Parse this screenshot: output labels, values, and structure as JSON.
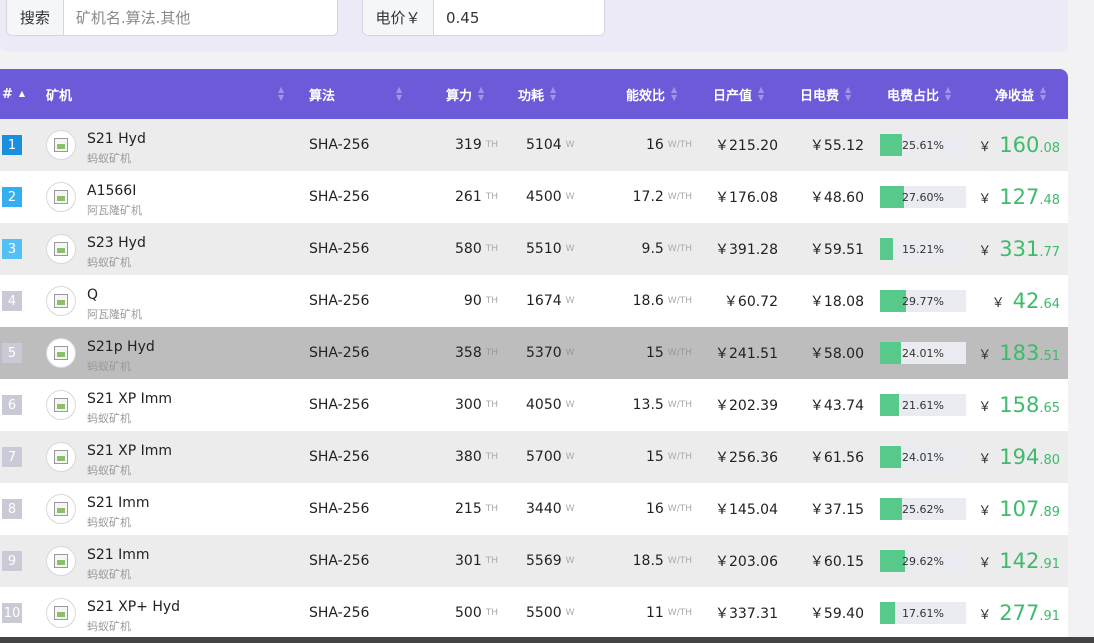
{
  "search": {
    "label": "搜索",
    "placeholder": "矿机名.算法.其他",
    "value": ""
  },
  "price": {
    "label": "电价￥",
    "value": "0.45"
  },
  "headers": {
    "rank": "#",
    "miner": "矿机",
    "algo": "算法",
    "hashrate": "算力",
    "power": "功耗",
    "efficiency": "能效比",
    "daily_output": "日产值",
    "daily_cost": "日电费",
    "cost_ratio": "电费占比",
    "net": "净收益"
  },
  "units": {
    "hash": "TH",
    "power": "W",
    "eff": "W/TH",
    "currency": "￥"
  },
  "rows": [
    {
      "rank": "1",
      "name": "S21 Hyd",
      "brand": "蚂蚁矿机",
      "algo": "SHA-256",
      "hash": "319",
      "power": "5104",
      "eff": "16",
      "output": "￥215.20",
      "cost": "￥55.12",
      "ratio": "25.61%",
      "ratio_value": 25.61,
      "net_int": "160",
      "net_dec": ".08"
    },
    {
      "rank": "2",
      "name": "A1566I",
      "brand": "阿瓦隆矿机",
      "algo": "SHA-256",
      "hash": "261",
      "power": "4500",
      "eff": "17.2",
      "output": "￥176.08",
      "cost": "￥48.60",
      "ratio": "27.60%",
      "ratio_value": 27.6,
      "net_int": "127",
      "net_dec": ".48"
    },
    {
      "rank": "3",
      "name": "S23 Hyd",
      "brand": "蚂蚁矿机",
      "algo": "SHA-256",
      "hash": "580",
      "power": "5510",
      "eff": "9.5",
      "output": "￥391.28",
      "cost": "￥59.51",
      "ratio": "15.21%",
      "ratio_value": 15.21,
      "net_int": "331",
      "net_dec": ".77"
    },
    {
      "rank": "4",
      "name": "Q",
      "brand": "阿瓦隆矿机",
      "algo": "SHA-256",
      "hash": "90",
      "power": "1674",
      "eff": "18.6",
      "output": "￥60.72",
      "cost": "￥18.08",
      "ratio": "29.77%",
      "ratio_value": 29.77,
      "net_int": "42",
      "net_dec": ".64"
    },
    {
      "rank": "5",
      "name": "S21p Hyd",
      "brand": "蚂蚁矿机",
      "algo": "SHA-256",
      "hash": "358",
      "power": "5370",
      "eff": "15",
      "output": "￥241.51",
      "cost": "￥58.00",
      "ratio": "24.01%",
      "ratio_value": 24.01,
      "net_int": "183",
      "net_dec": ".51"
    },
    {
      "rank": "6",
      "name": "S21 XP Imm",
      "brand": "蚂蚁矿机",
      "algo": "SHA-256",
      "hash": "300",
      "power": "4050",
      "eff": "13.5",
      "output": "￥202.39",
      "cost": "￥43.74",
      "ratio": "21.61%",
      "ratio_value": 21.61,
      "net_int": "158",
      "net_dec": ".65"
    },
    {
      "rank": "7",
      "name": "S21 XP Imm",
      "brand": "蚂蚁矿机",
      "algo": "SHA-256",
      "hash": "380",
      "power": "5700",
      "eff": "15",
      "output": "￥256.36",
      "cost": "￥61.56",
      "ratio": "24.01%",
      "ratio_value": 24.01,
      "net_int": "194",
      "net_dec": ".80"
    },
    {
      "rank": "8",
      "name": "S21 Imm",
      "brand": "蚂蚁矿机",
      "algo": "SHA-256",
      "hash": "215",
      "power": "3440",
      "eff": "16",
      "output": "￥145.04",
      "cost": "￥37.15",
      "ratio": "25.62%",
      "ratio_value": 25.62,
      "net_int": "107",
      "net_dec": ".89"
    },
    {
      "rank": "9",
      "name": "S21 Imm",
      "brand": "蚂蚁矿机",
      "algo": "SHA-256",
      "hash": "301",
      "power": "5569",
      "eff": "18.5",
      "output": "￥203.06",
      "cost": "￥60.15",
      "ratio": "29.62%",
      "ratio_value": 29.62,
      "net_int": "142",
      "net_dec": ".91"
    },
    {
      "rank": "10",
      "name": "S21 XP+ Hyd",
      "brand": "蚂蚁矿机",
      "algo": "SHA-256",
      "hash": "500",
      "power": "5500",
      "eff": "11",
      "output": "￥337.31",
      "cost": "￥59.40",
      "ratio": "17.61%",
      "ratio_value": 17.61,
      "net_int": "277",
      "net_dec": ".91"
    }
  ],
  "colors": {
    "header_bg": "#6b5bd9",
    "net_green": "#3dbb6b",
    "bar_green": "#57c98a",
    "hover_row": "#bdbdbd"
  }
}
